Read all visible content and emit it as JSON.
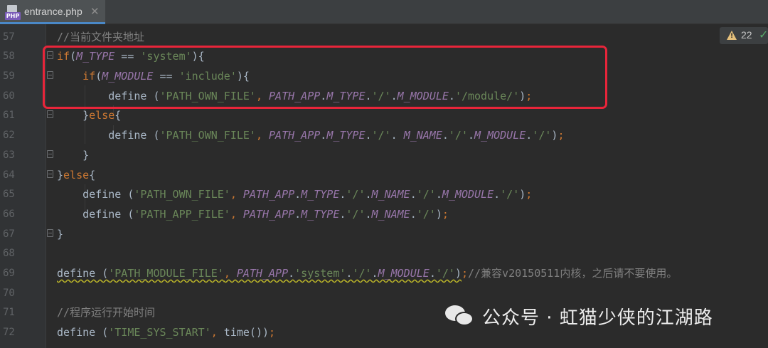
{
  "tab": {
    "title": "entrance.php",
    "file_type": "PHP",
    "close_glyph": "✕",
    "icon": "php-file-icon"
  },
  "inspections": {
    "warning_count": "22",
    "warning_icon": "warning-triangle-icon",
    "ok_icon": "check-icon"
  },
  "line_numbers": [
    "57",
    "58",
    "59",
    "60",
    "61",
    "62",
    "63",
    "64",
    "65",
    "66",
    "67",
    "68",
    "69",
    "70",
    "71",
    "72"
  ],
  "watermark": {
    "text": "公众号 · 虹猫少侠的江湖路",
    "icon": "wechat-icon"
  },
  "colors": {
    "keyword": "#cc7832",
    "constant": "#9876aa",
    "string": "#6a8759",
    "comment": "#808080",
    "highlight_box": "#e8253a",
    "background": "#2b2b2b"
  }
}
